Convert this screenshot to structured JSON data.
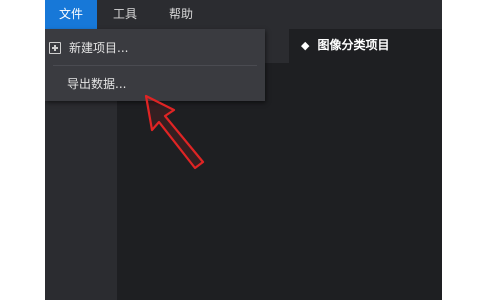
{
  "menubar": {
    "file": "文件",
    "tools": "工具",
    "help": "帮助"
  },
  "file_menu": {
    "items": [
      {
        "label": "新建项目...",
        "icon": "new-project-icon"
      },
      {
        "label": "导出数据..."
      }
    ]
  },
  "project": {
    "title": "图像分类项目",
    "icon": "diamond-icon"
  },
  "annotation": {
    "icon": "red-pointer-arrow",
    "color": "#e02424"
  },
  "colors": {
    "accent": "#1778d8",
    "menubar_bg": "#2b2c30",
    "workspace_bg": "#1e1f22",
    "dropdown_bg": "#3a3b40"
  }
}
